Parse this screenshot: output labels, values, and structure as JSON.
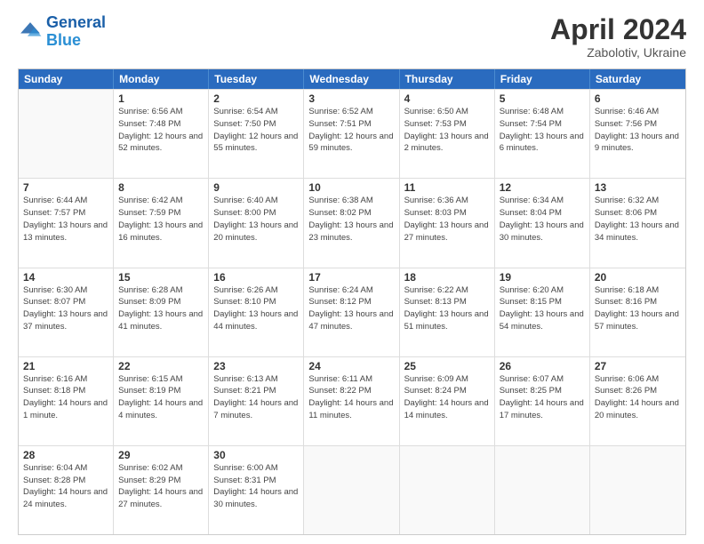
{
  "header": {
    "logo_line1": "General",
    "logo_line2": "Blue",
    "title": "April 2024",
    "subtitle": "Zabolotiv, Ukraine"
  },
  "calendar": {
    "days_of_week": [
      "Sunday",
      "Monday",
      "Tuesday",
      "Wednesday",
      "Thursday",
      "Friday",
      "Saturday"
    ],
    "weeks": [
      [
        {
          "day": "",
          "empty": true
        },
        {
          "day": "1",
          "sunrise": "6:56 AM",
          "sunset": "7:48 PM",
          "daylight": "12 hours and 52 minutes."
        },
        {
          "day": "2",
          "sunrise": "6:54 AM",
          "sunset": "7:50 PM",
          "daylight": "12 hours and 55 minutes."
        },
        {
          "day": "3",
          "sunrise": "6:52 AM",
          "sunset": "7:51 PM",
          "daylight": "12 hours and 59 minutes."
        },
        {
          "day": "4",
          "sunrise": "6:50 AM",
          "sunset": "7:53 PM",
          "daylight": "13 hours and 2 minutes."
        },
        {
          "day": "5",
          "sunrise": "6:48 AM",
          "sunset": "7:54 PM",
          "daylight": "13 hours and 6 minutes."
        },
        {
          "day": "6",
          "sunrise": "6:46 AM",
          "sunset": "7:56 PM",
          "daylight": "13 hours and 9 minutes."
        }
      ],
      [
        {
          "day": "7",
          "sunrise": "6:44 AM",
          "sunset": "7:57 PM",
          "daylight": "13 hours and 13 minutes."
        },
        {
          "day": "8",
          "sunrise": "6:42 AM",
          "sunset": "7:59 PM",
          "daylight": "13 hours and 16 minutes."
        },
        {
          "day": "9",
          "sunrise": "6:40 AM",
          "sunset": "8:00 PM",
          "daylight": "13 hours and 20 minutes."
        },
        {
          "day": "10",
          "sunrise": "6:38 AM",
          "sunset": "8:02 PM",
          "daylight": "13 hours and 23 minutes."
        },
        {
          "day": "11",
          "sunrise": "6:36 AM",
          "sunset": "8:03 PM",
          "daylight": "13 hours and 27 minutes."
        },
        {
          "day": "12",
          "sunrise": "6:34 AM",
          "sunset": "8:04 PM",
          "daylight": "13 hours and 30 minutes."
        },
        {
          "day": "13",
          "sunrise": "6:32 AM",
          "sunset": "8:06 PM",
          "daylight": "13 hours and 34 minutes."
        }
      ],
      [
        {
          "day": "14",
          "sunrise": "6:30 AM",
          "sunset": "8:07 PM",
          "daylight": "13 hours and 37 minutes."
        },
        {
          "day": "15",
          "sunrise": "6:28 AM",
          "sunset": "8:09 PM",
          "daylight": "13 hours and 41 minutes."
        },
        {
          "day": "16",
          "sunrise": "6:26 AM",
          "sunset": "8:10 PM",
          "daylight": "13 hours and 44 minutes."
        },
        {
          "day": "17",
          "sunrise": "6:24 AM",
          "sunset": "8:12 PM",
          "daylight": "13 hours and 47 minutes."
        },
        {
          "day": "18",
          "sunrise": "6:22 AM",
          "sunset": "8:13 PM",
          "daylight": "13 hours and 51 minutes."
        },
        {
          "day": "19",
          "sunrise": "6:20 AM",
          "sunset": "8:15 PM",
          "daylight": "13 hours and 54 minutes."
        },
        {
          "day": "20",
          "sunrise": "6:18 AM",
          "sunset": "8:16 PM",
          "daylight": "13 hours and 57 minutes."
        }
      ],
      [
        {
          "day": "21",
          "sunrise": "6:16 AM",
          "sunset": "8:18 PM",
          "daylight": "14 hours and 1 minute."
        },
        {
          "day": "22",
          "sunrise": "6:15 AM",
          "sunset": "8:19 PM",
          "daylight": "14 hours and 4 minutes."
        },
        {
          "day": "23",
          "sunrise": "6:13 AM",
          "sunset": "8:21 PM",
          "daylight": "14 hours and 7 minutes."
        },
        {
          "day": "24",
          "sunrise": "6:11 AM",
          "sunset": "8:22 PM",
          "daylight": "14 hours and 11 minutes."
        },
        {
          "day": "25",
          "sunrise": "6:09 AM",
          "sunset": "8:24 PM",
          "daylight": "14 hours and 14 minutes."
        },
        {
          "day": "26",
          "sunrise": "6:07 AM",
          "sunset": "8:25 PM",
          "daylight": "14 hours and 17 minutes."
        },
        {
          "day": "27",
          "sunrise": "6:06 AM",
          "sunset": "8:26 PM",
          "daylight": "14 hours and 20 minutes."
        }
      ],
      [
        {
          "day": "28",
          "sunrise": "6:04 AM",
          "sunset": "8:28 PM",
          "daylight": "14 hours and 24 minutes."
        },
        {
          "day": "29",
          "sunrise": "6:02 AM",
          "sunset": "8:29 PM",
          "daylight": "14 hours and 27 minutes."
        },
        {
          "day": "30",
          "sunrise": "6:00 AM",
          "sunset": "8:31 PM",
          "daylight": "14 hours and 30 minutes."
        },
        {
          "day": "",
          "empty": true
        },
        {
          "day": "",
          "empty": true
        },
        {
          "day": "",
          "empty": true
        },
        {
          "day": "",
          "empty": true
        }
      ]
    ],
    "sunrise_label": "Sunrise:",
    "sunset_label": "Sunset:",
    "daylight_label": "Daylight:"
  }
}
